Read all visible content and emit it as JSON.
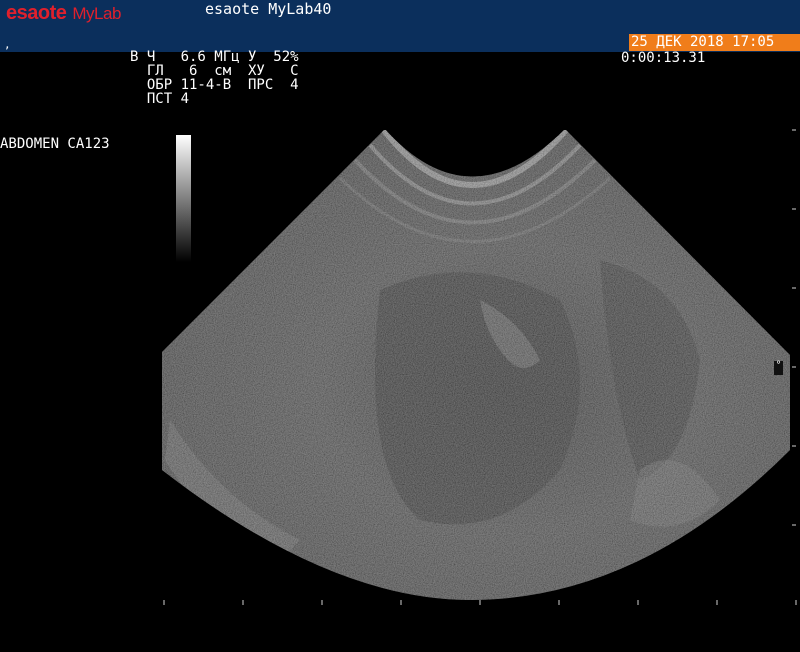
{
  "header": {
    "logo_brand": "esaote",
    "logo_product": "MyLab",
    "device_name": "esaote MyLab40",
    "corner_mark": ",",
    "datetime": "25 ДЕК 2018 17:05"
  },
  "timer": "0:00:13.31",
  "params": {
    "line1": "В Ч   6.6 МГц У  52%",
    "line2": "  ГЛ   6  см  ХУ   С",
    "line3": "  ОБР 11-4-В  ПРС  4",
    "line4": "  ПСТ 4"
  },
  "preset": "ABDOMEN  CA123",
  "focus_marker": "°",
  "colors": {
    "header_bg": "#0b2f5c",
    "date_bg": "#f07d1a",
    "logo": "#e0202c"
  }
}
